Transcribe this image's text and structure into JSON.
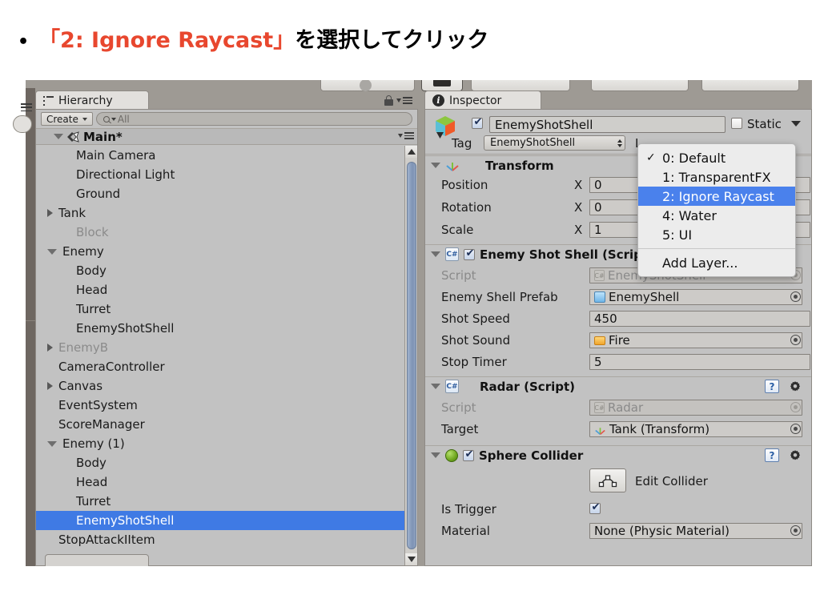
{
  "slide": {
    "bullet": "•",
    "quoted": "「2: Ignore Raycast」",
    "rest": "を選択してクリック",
    "accent_color": "#e8472e"
  },
  "hierarchy": {
    "tab_label": "Hierarchy",
    "create_label": "Create",
    "search_placeholder": "All",
    "scene_root": "Main*",
    "items": [
      {
        "label": "Main Camera",
        "depth": 2,
        "arrow": "none",
        "state": "normal"
      },
      {
        "label": "Directional Light",
        "depth": 2,
        "arrow": "none",
        "state": "normal"
      },
      {
        "label": "Ground",
        "depth": 2,
        "arrow": "none",
        "state": "normal"
      },
      {
        "label": "Tank",
        "depth": 1,
        "arrow": "closed",
        "state": "normal"
      },
      {
        "label": "Block",
        "depth": 2,
        "arrow": "none",
        "state": "dim"
      },
      {
        "label": "Enemy",
        "depth": 1,
        "arrow": "open",
        "state": "normal"
      },
      {
        "label": "Body",
        "depth": 2,
        "arrow": "none",
        "state": "normal"
      },
      {
        "label": "Head",
        "depth": 2,
        "arrow": "none",
        "state": "normal"
      },
      {
        "label": "Turret",
        "depth": 2,
        "arrow": "none",
        "state": "normal"
      },
      {
        "label": "EnemyShotShell",
        "depth": 2,
        "arrow": "none",
        "state": "normal"
      },
      {
        "label": "EnemyB",
        "depth": 1,
        "arrow": "closed",
        "state": "dim"
      },
      {
        "label": "CameraController",
        "depth": 1,
        "arrow": "none",
        "state": "normal"
      },
      {
        "label": "Canvas",
        "depth": 1,
        "arrow": "closed",
        "state": "normal"
      },
      {
        "label": "EventSystem",
        "depth": 1,
        "arrow": "none",
        "state": "normal"
      },
      {
        "label": "ScoreManager",
        "depth": 1,
        "arrow": "none",
        "state": "normal"
      },
      {
        "label": "Enemy (1)",
        "depth": 1,
        "arrow": "open",
        "state": "normal"
      },
      {
        "label": "Body",
        "depth": 2,
        "arrow": "none",
        "state": "normal"
      },
      {
        "label": "Head",
        "depth": 2,
        "arrow": "none",
        "state": "normal"
      },
      {
        "label": "Turret",
        "depth": 2,
        "arrow": "none",
        "state": "normal"
      },
      {
        "label": "EnemyShotShell",
        "depth": 2,
        "arrow": "none",
        "state": "selected"
      },
      {
        "label": "StopAttackIItem",
        "depth": 1,
        "arrow": "none",
        "state": "normal"
      }
    ],
    "selection_color": "#3f7ae4"
  },
  "inspector": {
    "tab_label": "Inspector",
    "object_name": "EnemyShotShell",
    "object_enabled": true,
    "static_label": "Static",
    "static_checked": false,
    "tag_label": "Tag",
    "tag_value": "EnemyShotShell",
    "layer_label": "L",
    "components": [
      {
        "title": "Transform",
        "icon": "transform-axis-icon",
        "rows": [
          {
            "label": "Position",
            "axis": "X",
            "value": "0"
          },
          {
            "label": "Rotation",
            "axis": "X",
            "value": "0"
          },
          {
            "label": "Scale",
            "axis": "X",
            "value": "1"
          }
        ]
      },
      {
        "title": "Enemy Shot Shell  (Script)",
        "icon": "csharp-script-icon",
        "enabled": true,
        "rows": [
          {
            "label": "Script",
            "value": "EnemyShotShell",
            "disabled": true,
            "icon": "script-icon",
            "picker": true
          },
          {
            "label": "Enemy Shell Prefab",
            "value": "EnemyShell",
            "disabled": false,
            "icon": "prefab-icon",
            "picker": true
          },
          {
            "label": "Shot Speed",
            "value": "450",
            "disabled": false,
            "icon": "none",
            "picker": false
          },
          {
            "label": "Shot Sound",
            "value": "Fire",
            "disabled": false,
            "icon": "audio-icon",
            "picker": true
          },
          {
            "label": "Stop Timer",
            "value": "5",
            "disabled": false,
            "icon": "none",
            "picker": false
          }
        ]
      },
      {
        "title": "Radar  (Script)",
        "icon": "csharp-script-icon",
        "rows": [
          {
            "label": "Script",
            "value": "Radar",
            "disabled": true,
            "icon": "script-icon",
            "picker": true
          },
          {
            "label": "Target",
            "value": "Tank (Transform)",
            "disabled": false,
            "icon": "axis-icon",
            "picker": true
          }
        ]
      },
      {
        "title": "Sphere Collider",
        "icon": "sphere-collider-icon",
        "enabled": true,
        "edit_collider_label": "Edit Collider",
        "rows": [
          {
            "label": "Is Trigger",
            "value": "",
            "checkbox": true
          },
          {
            "label": "Material",
            "value": "None (Physic Material)",
            "disabled": false,
            "icon": "none",
            "picker": true
          }
        ]
      }
    ]
  },
  "layer_dropdown": {
    "items": [
      {
        "label": "0: Default",
        "checked": true,
        "selected": false
      },
      {
        "label": "1: TransparentFX",
        "checked": false,
        "selected": false
      },
      {
        "label": "2: Ignore Raycast",
        "checked": false,
        "selected": true
      },
      {
        "label": "4: Water",
        "checked": false,
        "selected": false
      },
      {
        "label": "5: UI",
        "checked": false,
        "selected": false
      }
    ],
    "add_layer_label": "Add Layer...",
    "highlight_color": "#4a81ec"
  }
}
